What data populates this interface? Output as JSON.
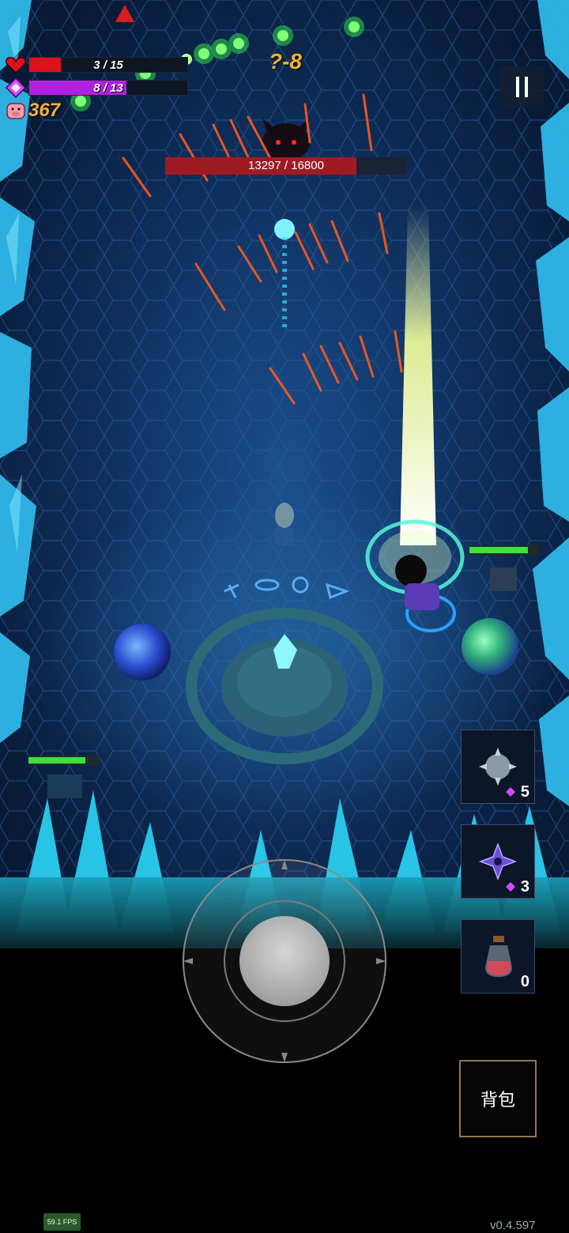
{
  "hud": {
    "hp": {
      "current": 3,
      "max": 15,
      "text": "3 / 15",
      "color": "#e0101c"
    },
    "mana": {
      "current": 8,
      "max": 13,
      "text": "8 / 13",
      "color": "#b020e0"
    },
    "coins": "367",
    "stage": "?-8"
  },
  "boss": {
    "current": 13297,
    "max": 16800,
    "text": "13297 / 16800",
    "color": "#9e1b22"
  },
  "enemy_hp_bars": [
    {
      "fraction": 0.84
    },
    {
      "fraction": 0.8
    }
  ],
  "skills": [
    {
      "name": "spiked-orb",
      "count": "5",
      "uses_gem": true
    },
    {
      "name": "shuriken",
      "count": "3",
      "uses_gem": true
    },
    {
      "name": "health-potion",
      "count": "0",
      "uses_gem": false
    }
  ],
  "bag_label": "背包",
  "fps": "59.1 FPS",
  "version": "v0.4.597",
  "colors": {
    "accent_cyan": "#37d3ff",
    "gold": "#f4b12c",
    "floor": "#0f2a55"
  }
}
